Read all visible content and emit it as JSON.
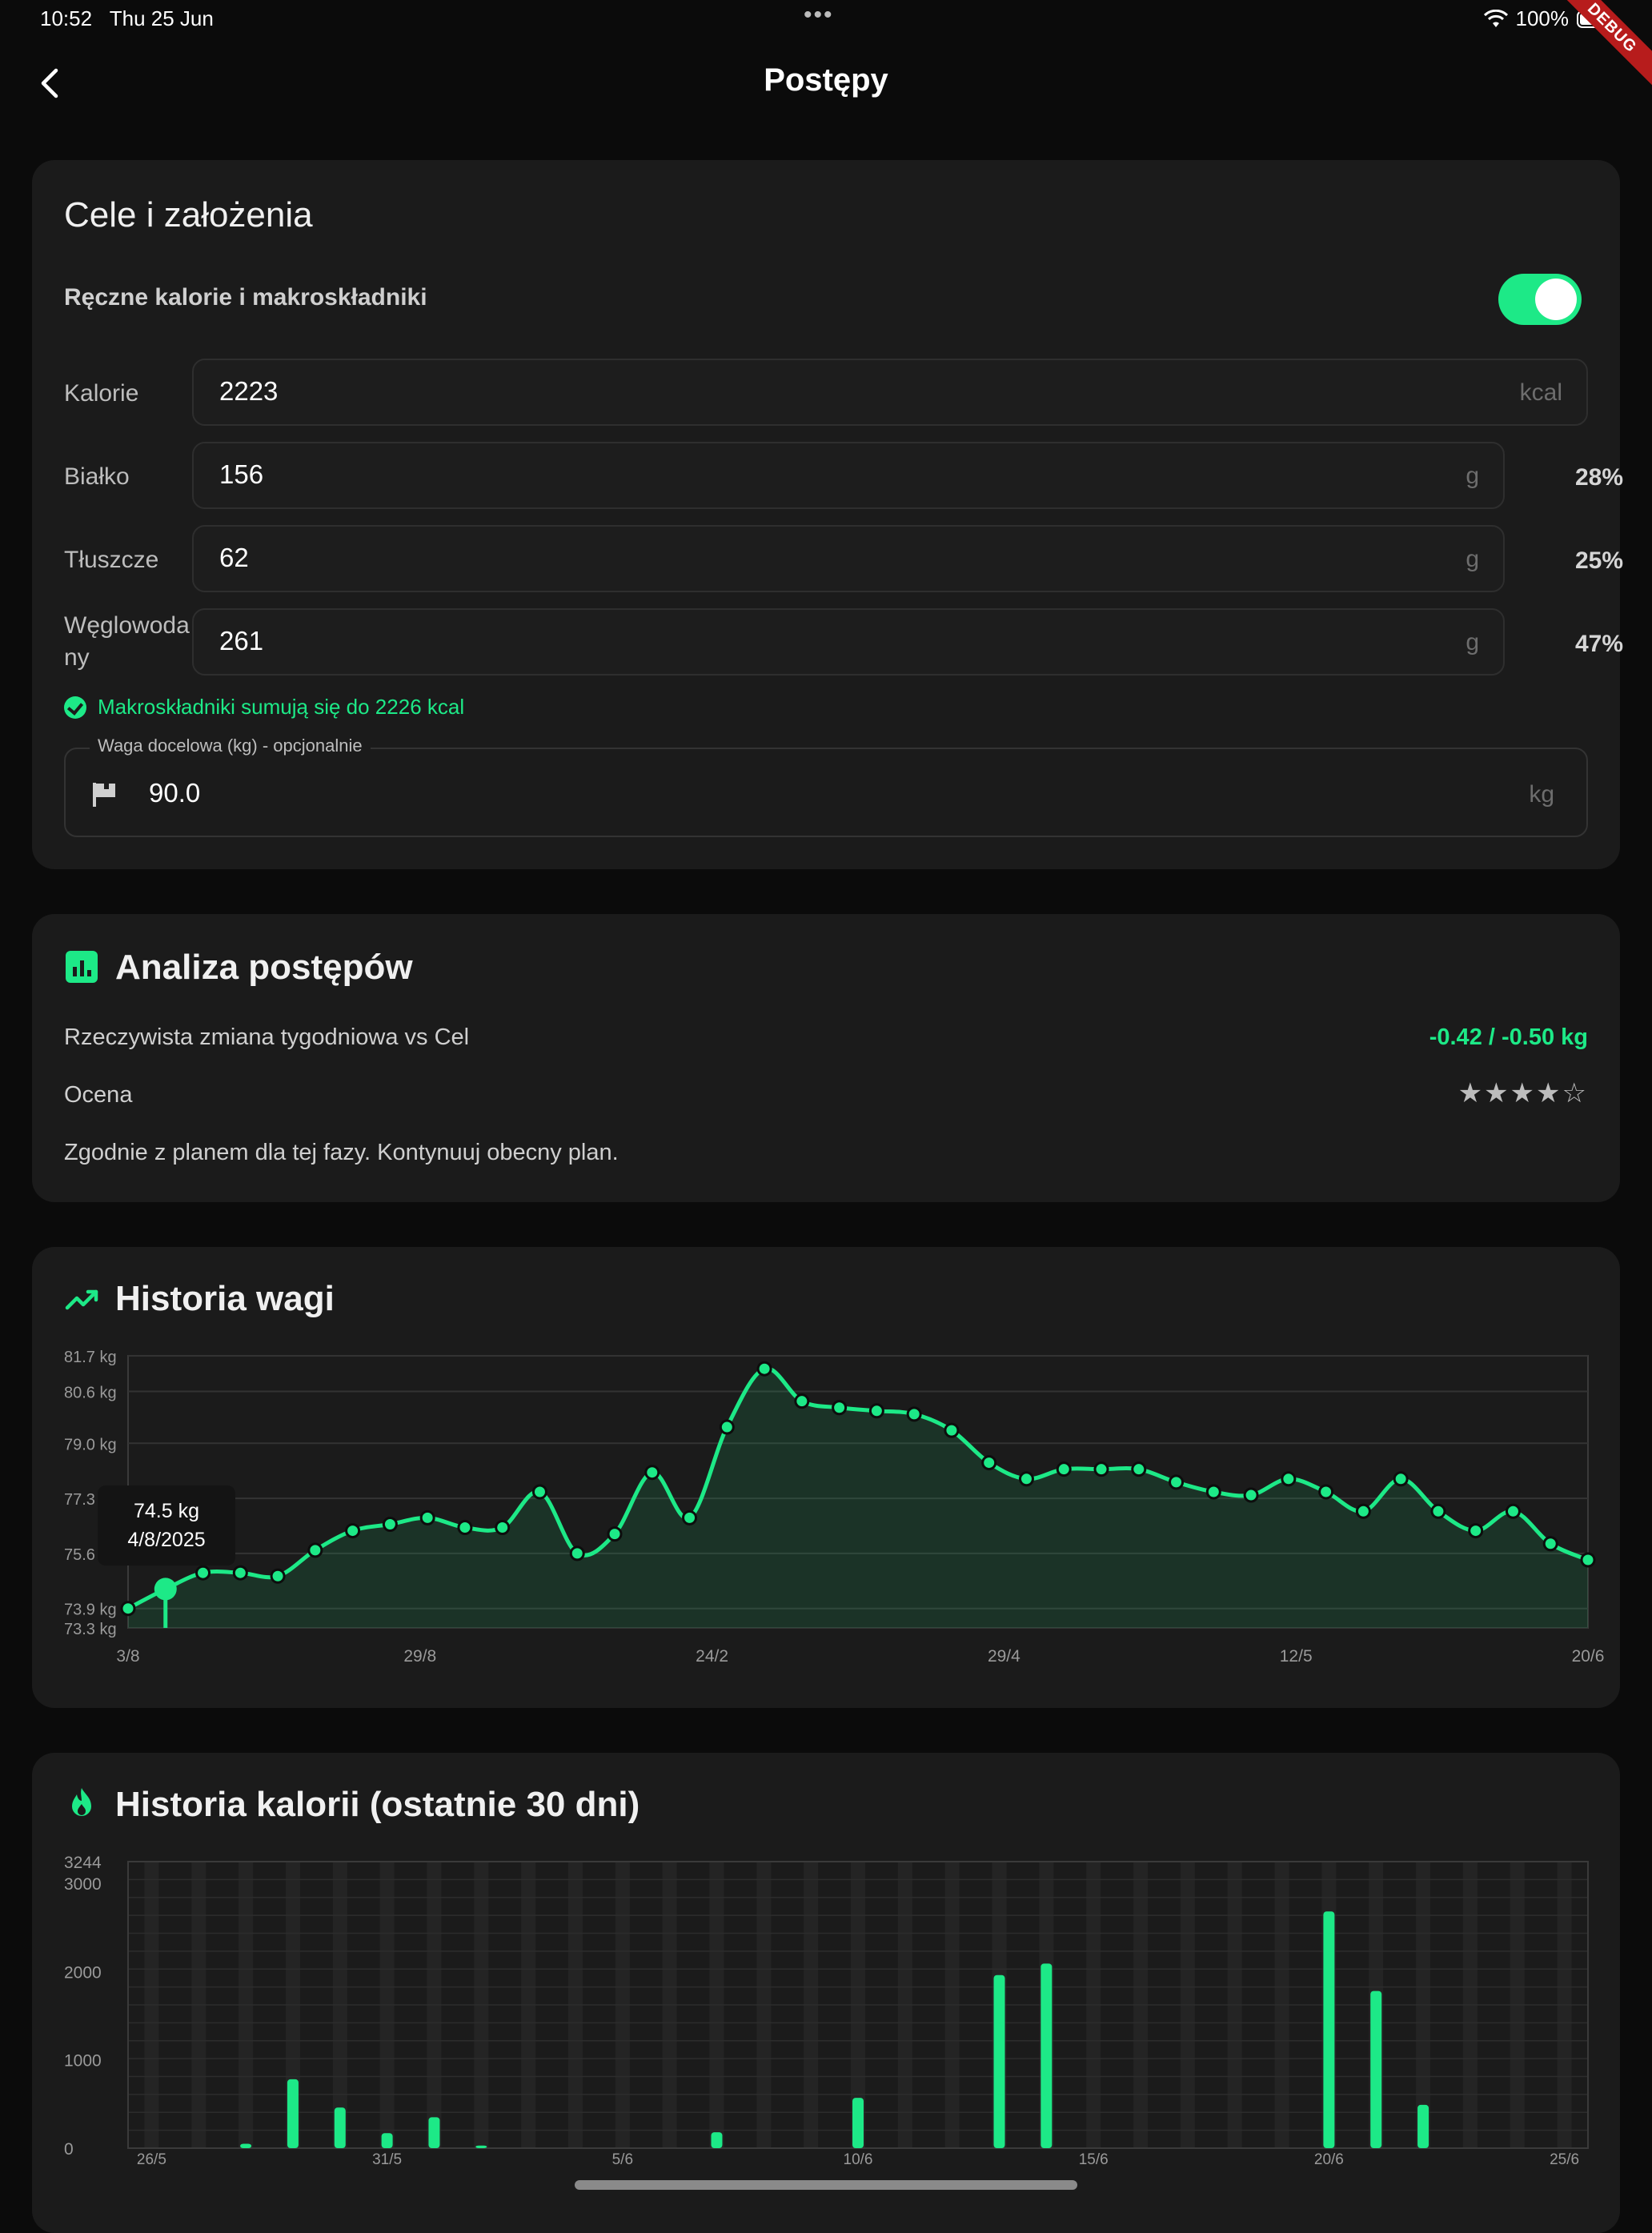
{
  "status_bar": {
    "time": "10:52",
    "date": "Thu 25 Jun",
    "battery": "100%",
    "debug_banner": "DEBUG"
  },
  "app_bar": {
    "title": "Postępy",
    "back_icon": "back-arrow-icon"
  },
  "goals": {
    "title": "Cele i założenia",
    "manual_label": "Ręczne kalorie i makroskładniki",
    "manual_enabled": true,
    "fields": [
      {
        "label": "Kalorie",
        "value": "2223",
        "unit": "kcal",
        "pct": ""
      },
      {
        "label": "Białko",
        "value": "156",
        "unit": "g",
        "pct": "28%"
      },
      {
        "label": "Tłuszcze",
        "value": "62",
        "unit": "g",
        "pct": "25%"
      },
      {
        "label_line1": "Węglowoda",
        "label_line2": "ny",
        "value": "261",
        "unit": "g",
        "pct": "47%"
      }
    ],
    "sum_message": "Makroskładniki sumują się do 2226 kcal",
    "target_weight": {
      "label": "Waga docelowa (kg) - opcjonalnie",
      "value": "90.0",
      "unit": "kg"
    }
  },
  "analysis": {
    "title": "Analiza postępów",
    "weekly_label": "Rzeczywista zmiana tygodniowa vs Cel",
    "weekly_value": "-0.42 / -0.50 kg",
    "rating_label": "Ocena",
    "rating_stars": "★★★★☆",
    "rating": 4,
    "rating_max": 5,
    "message": "Zgodnie z planem dla tej fazy. Kontynuuj obecny plan."
  },
  "weight_history": {
    "title": "Historia wagi"
  },
  "calorie_history": {
    "title": "Historia kalorii (ostatnie 30 dni)"
  },
  "chart_data": [
    {
      "type": "line",
      "title": "Historia wagi",
      "y_unit": "kg",
      "ylim": [
        73.3,
        81.7
      ],
      "y_ticks": [
        "81.7 kg",
        "80.6 kg",
        "79.0 kg",
        "77.3 kg",
        "75.6 kg",
        "73.9 kg",
        "73.3 kg"
      ],
      "y_tick_values": [
        81.7,
        80.6,
        79.0,
        77.3,
        75.6,
        73.9,
        73.3
      ],
      "x_ticks": [
        "3/8",
        "29/8",
        "24/2",
        "29/4",
        "12/5",
        "20/6"
      ],
      "y": [
        73.9,
        74.5,
        75.0,
        75.0,
        74.9,
        75.7,
        76.3,
        76.5,
        76.7,
        76.4,
        76.4,
        77.5,
        75.6,
        76.2,
        78.1,
        76.7,
        79.5,
        81.3,
        80.3,
        80.1,
        80.0,
        79.9,
        79.4,
        78.4,
        77.9,
        78.2,
        78.2,
        78.2,
        77.8,
        77.5,
        77.4,
        77.9,
        77.5,
        76.9,
        77.9,
        76.9,
        76.3,
        76.9,
        75.9,
        75.4
      ],
      "tooltip": {
        "weight": "74.5 kg",
        "date": "4/8/2025",
        "index": 1
      },
      "grid": true,
      "area_fill": true
    },
    {
      "type": "bar",
      "title": "Historia kalorii (ostatnie 30 dni)",
      "ylim": [
        0,
        3244
      ],
      "y_ticks": [
        "3244",
        "3000",
        "2000",
        "1000",
        "0"
      ],
      "y_tick_values": [
        3244,
        3000,
        2000,
        1000,
        0
      ],
      "x_ticks": [
        "26/5",
        "31/5",
        "5/6",
        "10/6",
        "15/6",
        "20/6",
        "25/6"
      ],
      "values": [
        0,
        0,
        50,
        780,
        460,
        170,
        350,
        30,
        0,
        0,
        0,
        0,
        180,
        0,
        0,
        570,
        0,
        0,
        1960,
        2090,
        0,
        0,
        0,
        0,
        0,
        2680,
        1780,
        490,
        0,
        0,
        0
      ],
      "grid": true
    }
  ]
}
